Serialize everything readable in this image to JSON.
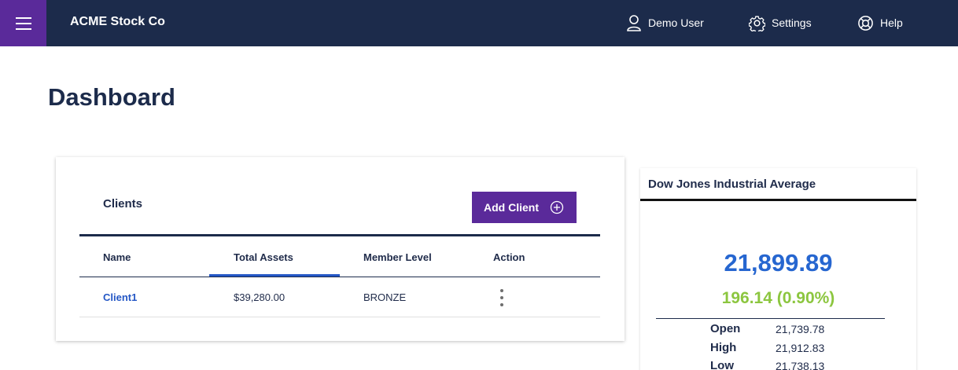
{
  "app": {
    "brand": "ACME Stock Co"
  },
  "nav": {
    "user_label": "Demo User",
    "settings_label": "Settings",
    "help_label": "Help"
  },
  "page": {
    "title": "Dashboard"
  },
  "clients": {
    "title": "Clients",
    "add_button_label": "Add Client",
    "columns": [
      "Name",
      "Total Assets",
      "Member Level",
      "Action"
    ],
    "sorted_column": "Total Assets",
    "rows": [
      {
        "name": "Client1",
        "total_assets": "$39,280.00",
        "member_level": "BRONZE"
      }
    ]
  },
  "dow": {
    "title": "Dow Jones Industrial Average",
    "value": "21,899.89",
    "change": "196.14 (0.90%)",
    "stats": [
      {
        "label": "Open",
        "value": "21,739.78"
      },
      {
        "label": "High",
        "value": "21,912.83"
      },
      {
        "label": "Low",
        "value": "21,738.13"
      }
    ]
  },
  "colors": {
    "header_bg": "#1c2b4b",
    "accent_purple": "#5a2a9a",
    "link_blue": "#2457c5",
    "positive_green": "#8cc63f"
  },
  "icons": {
    "menu": "hamburger-menu-icon",
    "user": "user-icon",
    "settings": "gear-icon",
    "help": "lifebuoy-icon",
    "add": "plus-circle-icon",
    "action": "kebab-menu-icon"
  }
}
